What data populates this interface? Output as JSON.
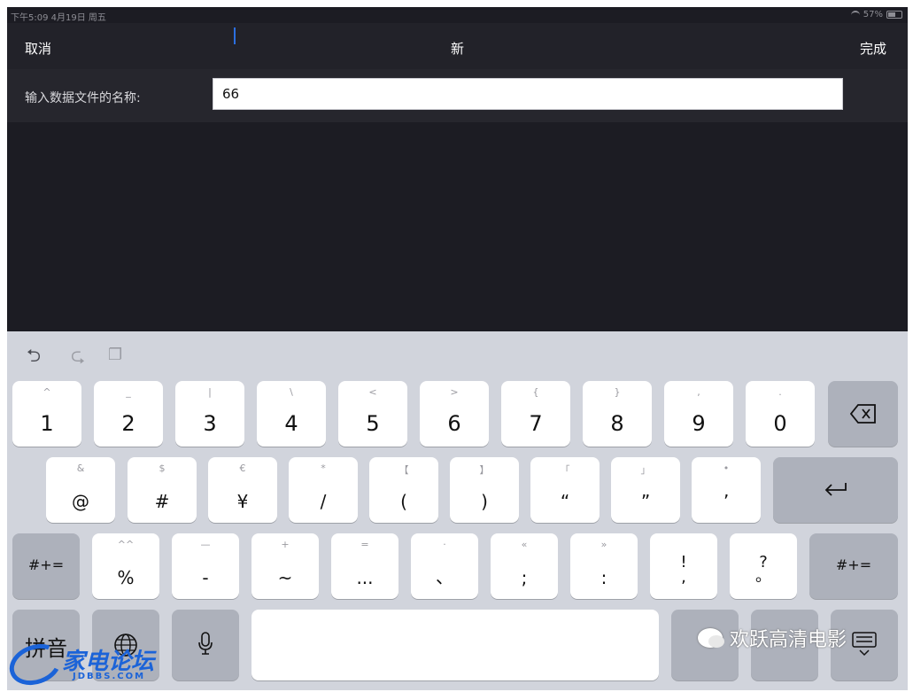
{
  "status_bar": {
    "time_date": "下午5:09  4月19日 周五",
    "battery": "57%"
  },
  "nav": {
    "cancel": "取消",
    "title": "新",
    "done": "完成"
  },
  "form": {
    "label": "输入数据文件的名称:",
    "value": "66"
  },
  "keyboard": {
    "assist_icons": [
      "undo-icon",
      "redo-icon",
      "paste-icon"
    ],
    "row1": [
      {
        "sub": "^",
        "main": "1"
      },
      {
        "sub": "_",
        "main": "2"
      },
      {
        "sub": "|",
        "main": "3"
      },
      {
        "sub": "\\",
        "main": "4"
      },
      {
        "sub": "<",
        "main": "5"
      },
      {
        "sub": ">",
        "main": "6"
      },
      {
        "sub": "{",
        "main": "7"
      },
      {
        "sub": "}",
        "main": "8"
      },
      {
        "sub": ",",
        "main": "9"
      },
      {
        "sub": ".",
        "main": "0"
      }
    ],
    "row2": [
      {
        "sub": "&",
        "main": "@"
      },
      {
        "sub": "$",
        "main": "#"
      },
      {
        "sub": "€",
        "main": "¥"
      },
      {
        "sub": "*",
        "main": "/"
      },
      {
        "sub": "【",
        "main": "("
      },
      {
        "sub": "】",
        "main": ")"
      },
      {
        "sub": "「",
        "main": "“"
      },
      {
        "sub": "」",
        "main": "”"
      },
      {
        "sub": "•",
        "main": "’"
      }
    ],
    "row3": [
      {
        "sub": "^^",
        "main": "%"
      },
      {
        "sub": "—",
        "main": "-"
      },
      {
        "sub": "+",
        "main": "~"
      },
      {
        "sub": "=",
        "main": "..."
      },
      {
        "sub": "·",
        "main": "、"
      },
      {
        "sub": "«",
        "main": ";"
      },
      {
        "sub": "»",
        "main": ":"
      }
    ],
    "row3_right": [
      {
        "top": "!",
        "bottom": ","
      },
      {
        "top": "?",
        "bottom": "。"
      }
    ],
    "symbol_toggle": "#+=",
    "pinyin": "拼音"
  },
  "watermarks": {
    "wechat": "欢跃高清电影",
    "logo": "家电论坛",
    "logo_sub": "JDBBS.COM"
  }
}
